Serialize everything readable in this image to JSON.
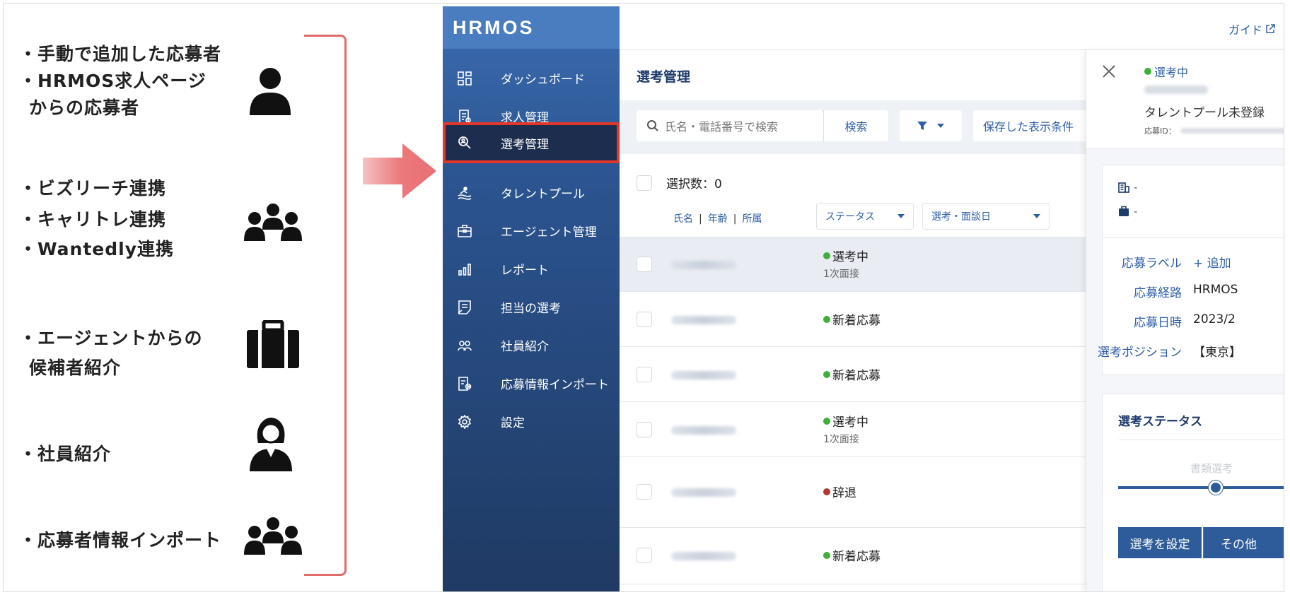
{
  "sources": [
    "・手動で追加した応募者",
    "・HRMOS求人ページ",
    "からの応募者",
    "・ビズリーチ連携",
    "・キャリトレ連携",
    "・Wantedly連携",
    "・エージェントからの",
    "候補者紹介",
    "・社員紹介",
    "・応募者情報インポート"
  ],
  "colors": {
    "accent": "#2f5fa7",
    "sidebar": "#2b5490",
    "active_border": "#e2372b",
    "arrow": "#e86f73",
    "green": "#3fae3b",
    "red": "#b03a2e"
  },
  "app": {
    "logo": "HRMOS",
    "guide": "ガイド",
    "nav": [
      {
        "label": "ダッシュボード",
        "icon": "dashboard-icon"
      },
      {
        "label": "求人管理",
        "icon": "job-icon"
      },
      {
        "label": "選考管理",
        "icon": "search-person-icon"
      },
      {
        "label": "タレントプール",
        "icon": "pool-icon"
      },
      {
        "label": "エージェント管理",
        "icon": "briefcase-icon"
      },
      {
        "label": "レポート",
        "icon": "report-icon"
      },
      {
        "label": "担当の選考",
        "icon": "assigned-icon"
      },
      {
        "label": "社員紹介",
        "icon": "people-icon"
      },
      {
        "label": "応募情報インポート",
        "icon": "import-icon"
      },
      {
        "label": "設定",
        "icon": "gear-icon"
      }
    ],
    "list": {
      "title": "選考管理",
      "search_placeholder": "氏名・電話番号で検索",
      "search_button": "検索",
      "saved_conditions": "保存した表示条件",
      "selected_count": "選択数：0",
      "col_name": "氏名",
      "col_age": "年齢",
      "col_affil": "所属",
      "col_status": "ステータス",
      "col_date": "選考・面談日",
      "rows": [
        {
          "status": "選考中",
          "sub": "1次面接",
          "dot": "green"
        },
        {
          "status": "新着応募",
          "sub": "",
          "dot": "green"
        },
        {
          "status": "新着応募",
          "sub": "",
          "dot": "green"
        },
        {
          "status": "選考中",
          "sub": "1次面接",
          "dot": "green"
        },
        {
          "status": "辞退",
          "sub": "",
          "dot": "red"
        },
        {
          "status": "新着応募",
          "sub": "",
          "dot": "green"
        }
      ]
    },
    "detail": {
      "status": "選考中",
      "talent_pool": "タレントプール未登録",
      "app_id_label": "応募ID：",
      "company_value": "-",
      "position_value": "-",
      "label_field": "応募ラベル",
      "label_add": "+ 追加",
      "route_field": "応募経路",
      "route_value": "HRMOS",
      "date_field": "応募日時",
      "date_value": "2023/2",
      "position_field": "選考ポジション",
      "position_val": "【東京】",
      "status_title": "選考ステータス",
      "step_label": "書類選考",
      "btn_set": "選考を設定",
      "btn_other": "その他"
    }
  }
}
